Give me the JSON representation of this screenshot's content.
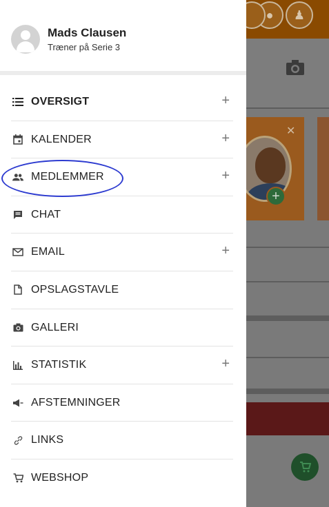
{
  "profile": {
    "name": "Mads Clausen",
    "role": "Træner på Serie 3"
  },
  "menu": {
    "items": [
      {
        "label": "OVERSIGT",
        "icon": "list-icon",
        "expandable": true
      },
      {
        "label": "KALENDER",
        "icon": "calendar-icon",
        "expandable": true
      },
      {
        "label": "MEDLEMMER",
        "icon": "people-icon",
        "expandable": true
      },
      {
        "label": "CHAT",
        "icon": "chat-icon",
        "expandable": false
      },
      {
        "label": "EMAIL",
        "icon": "mail-icon",
        "expandable": true
      },
      {
        "label": "OPSLAGSTAVLE",
        "icon": "document-icon",
        "expandable": false
      },
      {
        "label": "GALLERI",
        "icon": "camera-icon",
        "expandable": false
      },
      {
        "label": "STATISTIK",
        "icon": "bar-chart-icon",
        "expandable": true
      },
      {
        "label": "AFSTEMNINGER",
        "icon": "megaphone-icon",
        "expandable": false
      },
      {
        "label": "LINKS",
        "icon": "link-icon",
        "expandable": false
      },
      {
        "label": "WEBSHOP",
        "icon": "cart-icon",
        "expandable": false
      }
    ],
    "plus_symbol": "+"
  },
  "colors": {
    "highlight": "#2d3bd0",
    "overlay": "#7a7a7a",
    "brand_orange": "#e07b00"
  }
}
